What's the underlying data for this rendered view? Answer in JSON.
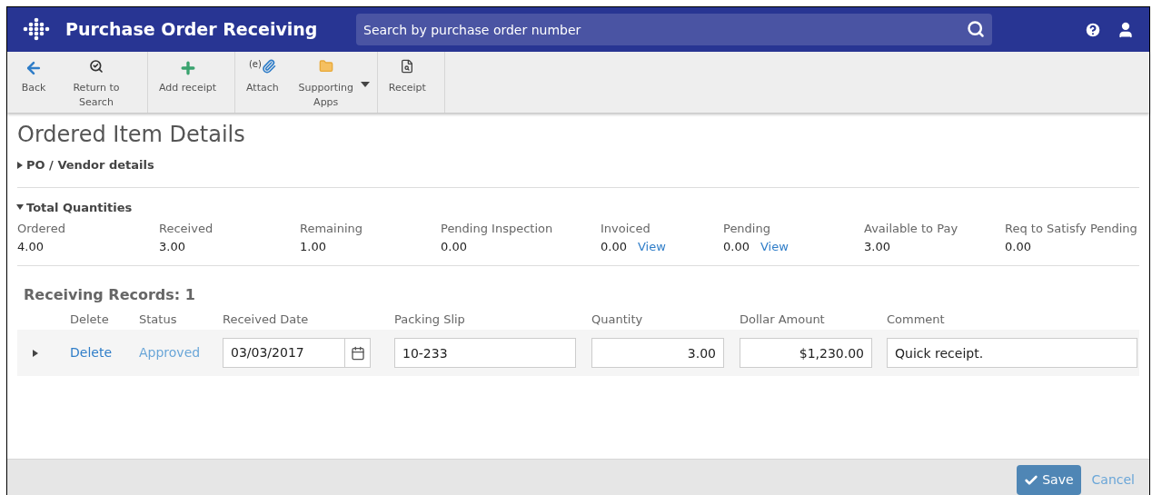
{
  "header": {
    "title": "Purchase Order Receiving",
    "search": {
      "placeholder": "Search by purchase order number"
    }
  },
  "toolbar": [
    {
      "items": [
        {
          "kind": "back",
          "label": "Back"
        },
        {
          "kind": "return",
          "label": "Return to Search"
        }
      ]
    },
    {
      "items": [
        {
          "kind": "add",
          "label": "Add receipt"
        }
      ]
    },
    {
      "items": [
        {
          "kind": "attach",
          "label": "Attach",
          "badge": "(e)"
        },
        {
          "kind": "folder",
          "label": "Supporting Apps",
          "dropdown": true
        }
      ]
    },
    {
      "items": [
        {
          "kind": "receipt",
          "label": "Receipt"
        }
      ]
    }
  ],
  "page_title": "Ordered Item Details",
  "sections": [
    {
      "title": "PO / Vendor details",
      "expanded": false
    },
    {
      "title": "Total Quantities",
      "expanded": true
    }
  ],
  "quantities": [
    {
      "label": "Ordered",
      "value": "4.00"
    },
    {
      "label": "Received",
      "value": "3.00"
    },
    {
      "label": "Remaining",
      "value": "1.00"
    },
    {
      "label": "Pending Inspection",
      "value": "0.00"
    },
    {
      "label": "Invoiced",
      "value": "0.00",
      "link": "View"
    },
    {
      "label": "Pending",
      "value": "0.00",
      "link": "View"
    },
    {
      "label": "Available to Pay",
      "value": "3.00"
    },
    {
      "label": "Req to Satisfy Pending",
      "value": "0.00"
    }
  ],
  "records": {
    "title": "Receiving Records: 1",
    "columns": [
      "Delete",
      "Status",
      "Received Date",
      "Packing Slip",
      "Quantity",
      "Dollar Amount",
      "Comment"
    ],
    "rows": [
      {
        "expanded": false,
        "delete": "Delete",
        "status": "Approved",
        "received_date": "03/03/2017",
        "packing_slip": "10-233",
        "quantity": "3.00",
        "dollar_amount": "$1,230.00",
        "comment": "Quick receipt."
      }
    ]
  },
  "footer": {
    "buttons": [
      "Save",
      "Cancel"
    ]
  }
}
